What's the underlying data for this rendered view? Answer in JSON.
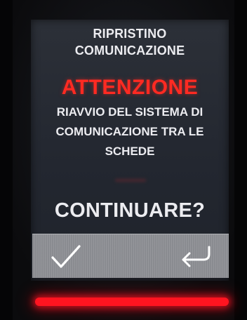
{
  "dialog": {
    "title_line1": "RIPRISTINO",
    "title_line2": "COMUNICAZIONE",
    "warning": "ATTENZIONE",
    "message_line1": "RIAVVIO DEL SISTEMA DI",
    "message_line2": "COMUNICAZIONE TRA LE",
    "message_line3": "SCHEDE",
    "question": "CONTINUARE?"
  },
  "actions": {
    "confirm_icon": "checkmark-icon",
    "back_icon": "return-arrow-icon"
  },
  "colors": {
    "warning": "#ff2a22",
    "text": "#ececf0",
    "screen_background": "#262a32",
    "action_bar": "#8f9196",
    "status_led": "#ff1420"
  }
}
